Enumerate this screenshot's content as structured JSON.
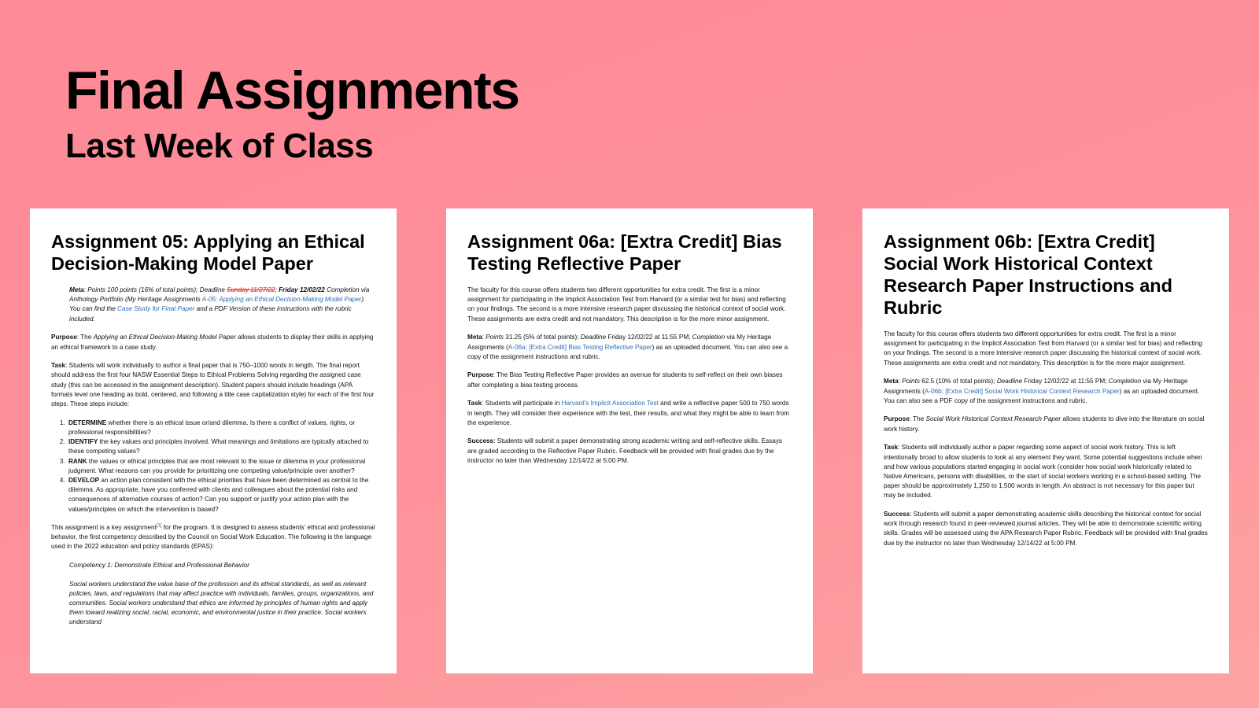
{
  "slide": {
    "title": "Final Assignments",
    "subtitle": "Last Week of Class"
  },
  "a05": {
    "title": "Assignment 05: Applying an Ethical Decision-Making Model Paper",
    "meta": {
      "label": "Meta",
      "t1": ": Points 100 points (16% of total points); Deadline ",
      "old_deadline": "Sunday 11/27/22",
      "t2": "; ",
      "new_deadline": "Friday 12/02/22",
      "t3": " Completion via Anthology Portfolio (My Heritage Assignments ",
      "link1": "A-05: Applying an Ethical Decision-Making Model Paper",
      "t4": "). You can find the ",
      "link2": "Case Study for Final Paper",
      "t5": " and a PDF Version of these instructions with the rubric included."
    },
    "purpose": {
      "label": "Purpose",
      "t1": ": The ",
      "title": "Applying an Ethical Decision-Making Model Paper",
      "t2": " allows students to display their skills in applying an ethical framework to a case study."
    },
    "task": {
      "label": "Task",
      "text": ": Students will work individually to author a final paper that is 750–1000 words in length. The final report should address the first four NASW Essential Steps to Ethical Problems Solving regarding the assigned case study (this can be accessed in the assignment description). Student papers should include headings (APA formats level one heading as bold, centered, and following a title case capitalization style) for each of the first four steps. These steps include:"
    },
    "steps": [
      {
        "term": "DETERMINE",
        "text": " whether there is an ethical issue or/and dilemma. Is there a conflict of values, rights, or professional responsibilities?"
      },
      {
        "term": "IDENTIFY",
        "text": " the key values and principles involved. What meanings and limitations are typically attached to these competing values?"
      },
      {
        "term": "RANK",
        "text": " the values or ethical principles that are most relevant to the issue or dilemma in your professional judgment. What reasons can you provide for prioritizing one competing value/principle over another?"
      },
      {
        "term": "DEVELOP",
        "text": " an action plan consistent with the ethical priorities that have been determined as central to the dilemma. As appropriate, have you conferred with clients and colleagues about the potential risks and consequences of alternative courses of action? Can you support or justify your action plan with the values/principles on which the intervention is based?"
      }
    ],
    "key": {
      "t1": "This assignment is a key assignment",
      "footnote": "[1]",
      "t2": " for the program. It is designed to assess students' ethical and professional behavior, the first competency described by the Council on Social Work Education. The following is the language used in the 2022 education and policy standards (EPAS):"
    },
    "competency": "Competency 1: Demonstrate Ethical and Professional Behavior",
    "quote": "Social workers understand the value base of the profession and its ethical standards, as well as relevant policies, laws, and regulations that may affect practice with individuals, families, groups, organizations, and communities. Social workers understand that ethics are informed by principles of human rights and apply them toward realizing social, racial, economic, and environmental justice in their practice. Social workers understand"
  },
  "a06a": {
    "title": "Assignment 06a: [Extra Credit] Bias Testing Reflective Paper",
    "intro": "The faculty for this course offers students two different opportunities for extra credit. The first is a minor assignment for participating in the Implicit Association Test from Harvard (or a similar test for bias) and reflecting on your findings. The second is a more intensive research paper discussing the historical context of social work. These assignments are extra credit and not mandatory. This description is for the more minor assignment.",
    "meta": {
      "label": "Meta",
      "t1": ": ",
      "points": "Points",
      "t2": " 31.25 (5% of total points); ",
      "deadline": "Deadline",
      "t3": " Friday 12/02/22 at 11:55 PM; ",
      "completion": "Completion",
      "t4": " via My Heritage Assignments (",
      "link": "A-06a: [Extra Credit] Bias Testing Reflective Paper",
      "t5": ") as an uploaded document. You can also see a copy of the assignment instructions and rubric."
    },
    "purpose": {
      "label": "Purpose",
      "text": ": The Bias Testing Reflective Paper provides an avenue for students to self-reflect on their own biases after completing a bias testing process."
    },
    "task": {
      "label": "Task",
      "t1": ": Students will participate in ",
      "link": "Harvard's Implicit Association Test",
      "t2": " and write a reflective paper 500 to 750 words in length. They will consider their experience with the test, their results, and what they might be able to learn from the experience."
    },
    "success": {
      "label": "Success",
      "text": ": Students will submit a paper demonstrating strong academic writing and self-reflective skills. Essays are graded according to the Reflective Paper Rubric. Feedback will be provided with final grades due by the instructor no later than Wednesday 12/14/22 at 5:00 PM."
    }
  },
  "a06b": {
    "title": "Assignment 06b: [Extra Credit] Social Work Historical Context Research Paper Instructions and Rubric",
    "intro": "The faculty for this course offers students two different opportunities for extra credit. The first is a minor assignment for participating in the Implicit Association Test from Harvard (or a similar test for bias) and reflecting on your findings. The second is a more intensive research paper discussing the historical context of social work. These assignments are extra credit and not mandatory. This description is for the more major assignment.",
    "meta": {
      "label": "Meta",
      "t1": ": ",
      "points": "Points",
      "t2": " 62.5 (10% of total points); ",
      "deadline": "Deadline",
      "t3": " Friday 12/02/22 at 11:55 PM; ",
      "completion": "Completion",
      "t4": " via My Heritage Assignments (",
      "link": "A-06b: [Extra Credit] Social Work Historical Context Research Paper",
      "t5": ") as an uploaded document. You can also see a PDF copy of the assignment instructions and rubric."
    },
    "purpose": {
      "label": "Purpose",
      "t1": ": The ",
      "title": "Social Work Historical Context Research Paper",
      "t2": " allows students to dive into the literature on social work history."
    },
    "task": {
      "label": "Task",
      "text": ": Students will individually author a paper regarding some aspect of social work history. This is left intentionally broad to allow students to look at any element they want. Some potential suggestions include when and how various populations started engaging in social work (consider how social work historically related to Native Americans, persons with disabilities, or the start of social workers working in a school-based setting. The paper should be approximately 1,250 to 1,500 words in length. An abstract is not necessary for this paper but may be included."
    },
    "success": {
      "label": "Success",
      "text": ": Students will submit a paper demonstrating academic skills describing the historical context for social work through research found in peer-reviewed journal articles. They will be able to demonstrate scientific writing skills. Grades will be assessed using the APA Research Paper Rubric. Feedback will be provided with final grades due by the instructor no later than Wednesday 12/14/22 at 5:00 PM."
    }
  }
}
